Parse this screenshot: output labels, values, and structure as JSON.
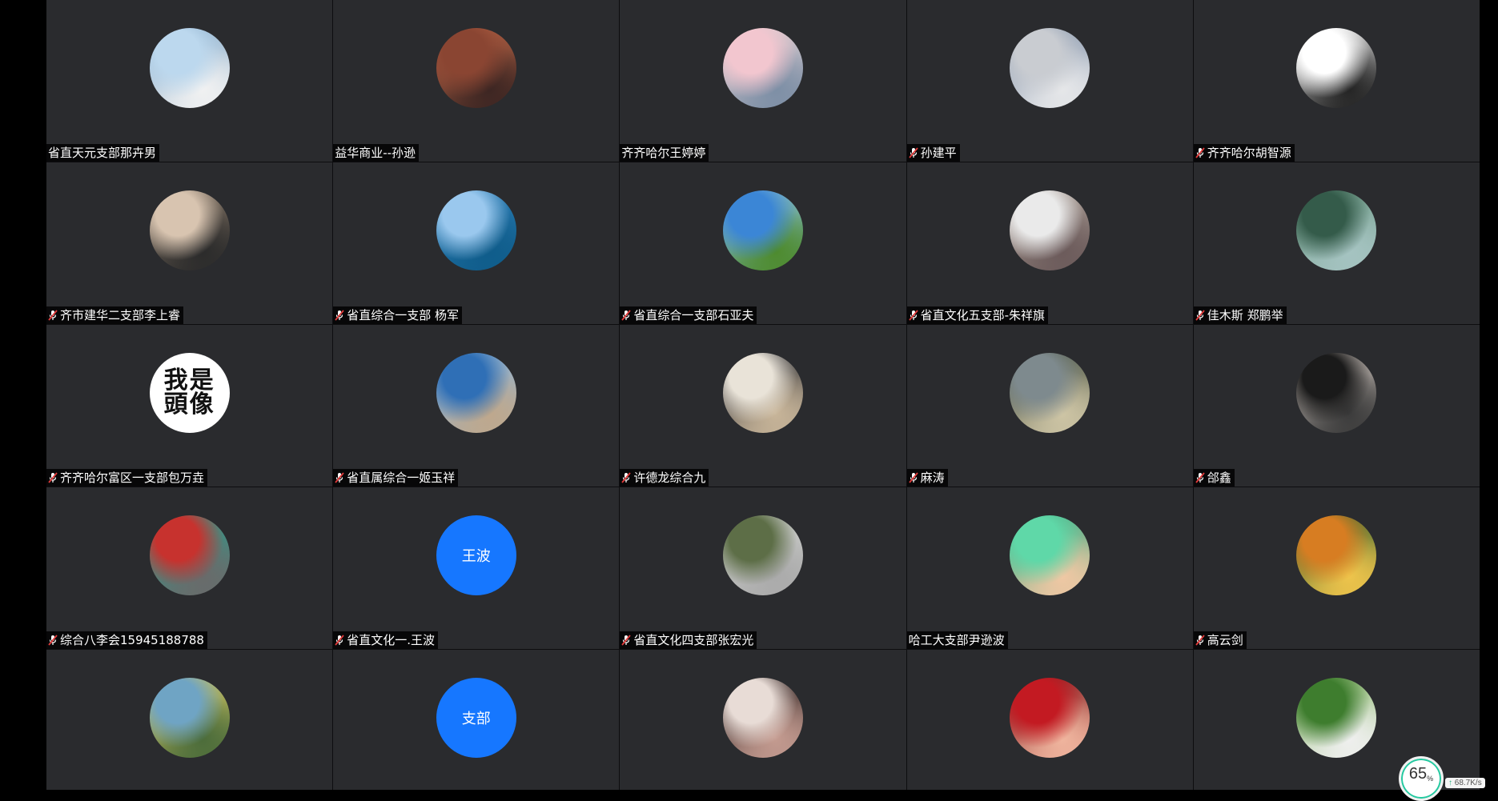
{
  "participants": [
    {
      "name": "省直天元支部那卉男",
      "muted": false,
      "avatar": "photo",
      "colors": [
        "#bcd8ee",
        "#7fa6c7",
        "#f2f2f2"
      ],
      "icon": "avatar-photo-icon"
    },
    {
      "name": "益华商业--孙逊",
      "muted": false,
      "avatar": "photo",
      "colors": [
        "#8a4532",
        "#c86c4a",
        "#3b2522"
      ],
      "icon": "avatar-photo-icon"
    },
    {
      "name": "齐齐哈尔王婷婷",
      "muted": false,
      "avatar": "photo",
      "colors": [
        "#f2c6cf",
        "#e8d5d6",
        "#7c8ea5"
      ],
      "icon": "avatar-photo-icon"
    },
    {
      "name": "孙建平",
      "muted": true,
      "avatar": "photo",
      "colors": [
        "#c9ccd1",
        "#7d8ea6",
        "#e7e8ea"
      ],
      "icon": "avatar-photo-icon"
    },
    {
      "name": "齐齐哈尔胡智源",
      "muted": true,
      "avatar": "photo",
      "colors": [
        "#ffffff",
        "#e8e8e8",
        "#222222"
      ],
      "icon": "avatar-photo-icon"
    },
    {
      "name": "齐市建华二支部李上睿",
      "muted": true,
      "avatar": "photo",
      "colors": [
        "#d8c4b0",
        "#8a7a6a",
        "#2a2a2a"
      ],
      "icon": "avatar-photo-icon"
    },
    {
      "name": "省直综合一支部 杨军",
      "muted": true,
      "avatar": "photo",
      "colors": [
        "#9ac8ee",
        "#2d7fb7",
        "#0f5c8a"
      ],
      "icon": "avatar-photo-icon"
    },
    {
      "name": "省直综合一支部石亚夫",
      "muted": true,
      "avatar": "photo",
      "colors": [
        "#3b86d6",
        "#8ec3f0",
        "#4d8a2c"
      ],
      "icon": "avatar-photo-icon"
    },
    {
      "name": "省直文化五支部-朱祥旗",
      "muted": true,
      "avatar": "photo",
      "colors": [
        "#eaeaea",
        "#b0a49b",
        "#6b5a5a"
      ],
      "icon": "avatar-photo-icon"
    },
    {
      "name": "佳木斯 郑鹏举",
      "muted": true,
      "avatar": "photo",
      "colors": [
        "#345b4a",
        "#6e9a86",
        "#a6c4c2"
      ],
      "icon": "avatar-photo-icon"
    },
    {
      "name": "齐齐哈尔富区一支部包万垚",
      "muted": true,
      "avatar": "text-image",
      "text": "我是頭像",
      "colors": [
        "#ffffff",
        "#ffffff",
        "#ffffff"
      ],
      "icon": "avatar-photo-icon"
    },
    {
      "name": "省直属综合一姬玉祥",
      "muted": true,
      "avatar": "photo",
      "colors": [
        "#2f6fb6",
        "#87b5e0",
        "#bfa88c"
      ],
      "icon": "avatar-photo-icon"
    },
    {
      "name": "许德龙综合九",
      "muted": true,
      "avatar": "photo",
      "colors": [
        "#e9e3d8",
        "#2b2e36",
        "#c9b69a"
      ],
      "icon": "avatar-photo-icon"
    },
    {
      "name": "麻涛",
      "muted": true,
      "avatar": "photo",
      "colors": [
        "#7e8a8e",
        "#3f4a3c",
        "#cfc6a6"
      ],
      "icon": "avatar-photo-icon"
    },
    {
      "name": "郃鑫",
      "muted": true,
      "avatar": "photo",
      "colors": [
        "#1a1a1a",
        "#d9cfc8",
        "#3a3a3a"
      ],
      "icon": "avatar-photo-icon"
    },
    {
      "name": "综合八李会15945188788",
      "muted": true,
      "avatar": "photo",
      "colors": [
        "#c7322e",
        "#2aa08e",
        "#6a6a6a"
      ],
      "icon": "avatar-photo-icon"
    },
    {
      "name": "省直文化一.王波",
      "muted": true,
      "avatar": "initials",
      "text": "王波",
      "colors": [
        "#1677ff",
        "#1677ff",
        "#1677ff"
      ],
      "icon": "avatar-initials-icon"
    },
    {
      "name": "省直文化四支部张宏光",
      "muted": true,
      "avatar": "photo",
      "colors": [
        "#5d6e47",
        "#d4d6d3",
        "#aaaaaa"
      ],
      "icon": "avatar-photo-icon"
    },
    {
      "name": "哈工大支部尹逊波",
      "muted": false,
      "avatar": "photo",
      "colors": [
        "#5fd8a8",
        "#2ea880",
        "#f2c8a4"
      ],
      "icon": "avatar-photo-icon"
    },
    {
      "name": "高云剑",
      "muted": true,
      "avatar": "photo",
      "colors": [
        "#d77d22",
        "#2d5a2a",
        "#f0c54c"
      ],
      "icon": "avatar-photo-icon"
    },
    {
      "name": "",
      "muted": false,
      "avatar": "photo",
      "colors": [
        "#6fa4c4",
        "#e4d36a",
        "#4a6b3a"
      ],
      "icon": "avatar-photo-icon"
    },
    {
      "name": "",
      "muted": false,
      "avatar": "initials",
      "text": "支部",
      "colors": [
        "#1677ff",
        "#1677ff",
        "#1677ff"
      ],
      "icon": "avatar-initials-icon"
    },
    {
      "name": "",
      "muted": false,
      "avatar": "photo",
      "colors": [
        "#e8dcd6",
        "#2a2020",
        "#c59c91"
      ],
      "icon": "avatar-photo-icon"
    },
    {
      "name": "",
      "muted": false,
      "avatar": "photo",
      "colors": [
        "#c31a22",
        "#7a0d12",
        "#f1b7a0"
      ],
      "icon": "avatar-photo-icon"
    },
    {
      "name": "",
      "muted": false,
      "avatar": "photo",
      "colors": [
        "#3e7d2e",
        "#8ab76a",
        "#f0f0f0"
      ],
      "icon": "avatar-photo-icon"
    }
  ],
  "network": {
    "percent": "65",
    "percent_unit": "%",
    "rate": "68.7K/s",
    "up_arrow": "↑",
    "accent": "#24c9a0"
  }
}
